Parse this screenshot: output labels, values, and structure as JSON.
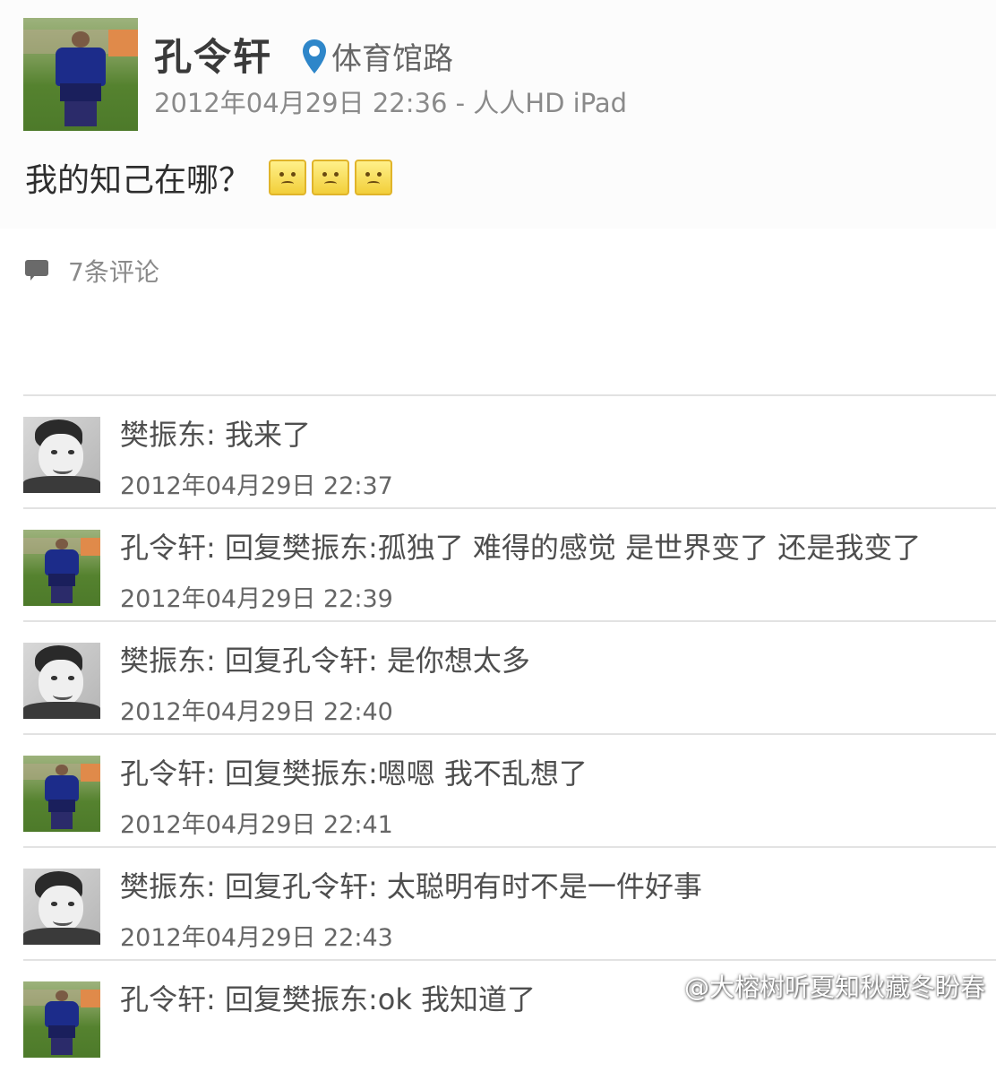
{
  "post": {
    "author": "孔令轩",
    "location": "体育馆路",
    "meta": "2012年04月29日 22:36 - 人人HD iPad",
    "text": "我的知己在哪？",
    "emoji_count": 3
  },
  "comments_header": {
    "count_label": "7条评论"
  },
  "comments": [
    {
      "name": "樊振东",
      "sep": ": ",
      "text": "我来了",
      "time": "2012年04月29日 22:37",
      "avatar": "face"
    },
    {
      "name": "孔令轩",
      "sep": ": ",
      "text": "回复樊振东:孤独了 难得的感觉 是世界变了 还是我变了",
      "time": "2012年04月29日 22:39",
      "avatar": "player"
    },
    {
      "name": "樊振东",
      "sep": ": ",
      "text": "回复孔令轩: 是你想太多",
      "time": "2012年04月29日 22:40",
      "avatar": "face"
    },
    {
      "name": "孔令轩",
      "sep": ": ",
      "text": "回复樊振东:嗯嗯 我不乱想了",
      "time": "2012年04月29日 22:41",
      "avatar": "player"
    },
    {
      "name": "樊振东",
      "sep": ": ",
      "text": "回复孔令轩: 太聪明有时不是一件好事",
      "time": "2012年04月29日 22:43",
      "avatar": "face"
    },
    {
      "name": "孔令轩",
      "sep": ": ",
      "text": "回复樊振东:ok 我知道了",
      "time": "",
      "avatar": "player"
    }
  ],
  "watermark": "@大榕树听夏知秋藏冬盼春"
}
